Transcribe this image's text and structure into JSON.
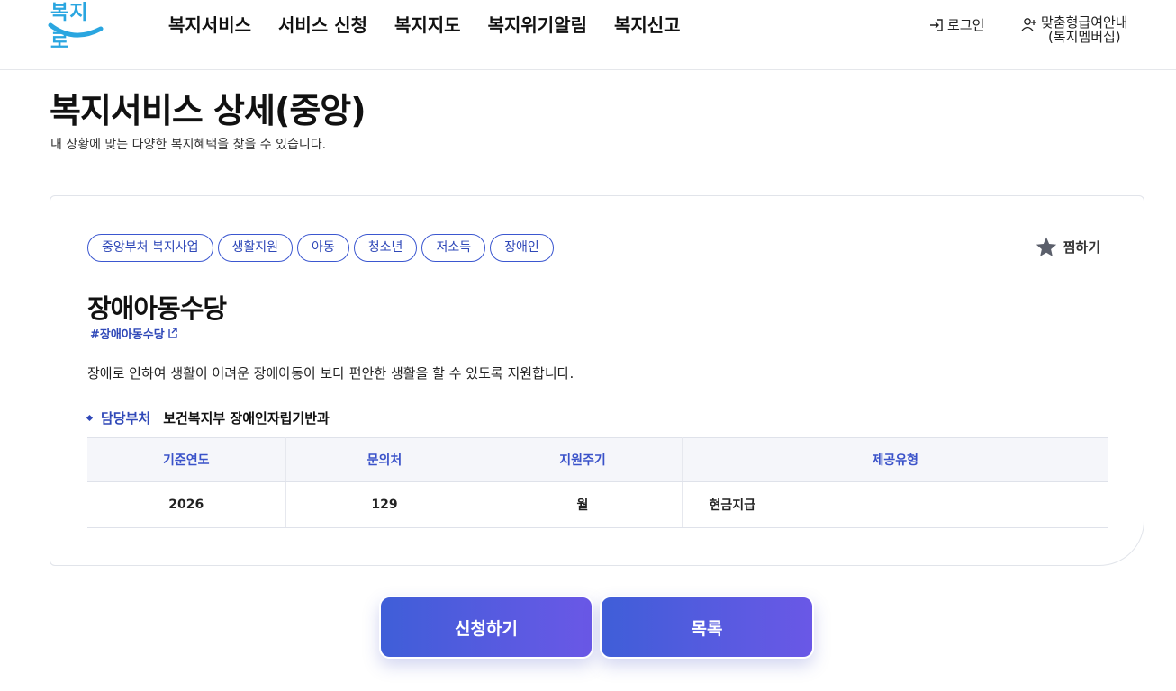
{
  "header": {
    "logo_text": "복지로",
    "nav": [
      "복지서비스",
      "서비스 신청",
      "복지지도",
      "복지위기알림",
      "복지신고"
    ],
    "login_label": "로그인",
    "member_label_line1": "맞춤형급여안내",
    "member_label_line2": "(복지멤버십)"
  },
  "page": {
    "title": "복지서비스 상세(중앙)",
    "subtitle": "내 상황에 맞는 다양한 복지혜택을 찾을 수 있습니다."
  },
  "service": {
    "tags": [
      "중앙부처 복지사업",
      "생활지원",
      "아동",
      "청소년",
      "저소득",
      "장애인"
    ],
    "favorite_label": "찜하기",
    "title": "장애아동수당",
    "hashtag": "#장애아동수당",
    "description": "장애로 인하여 생활이 어려운 장애아동이 보다 편안한 생활을 할 수 있도록 지원합니다.",
    "dept_label": "담당부처",
    "dept_value": "보건복지부 장애인자립기반과",
    "table": {
      "headers": [
        "기준연도",
        "문의처",
        "지원주기",
        "제공유형"
      ],
      "row": [
        "2026",
        "129",
        "월",
        "현금지급"
      ]
    }
  },
  "actions": {
    "apply_label": "신청하기",
    "list_label": "목록"
  },
  "colors": {
    "accent": "#2f48b8",
    "logo": "#2aa6e0",
    "button_start": "#3f5ed8",
    "button_end": "#6a58e6"
  }
}
